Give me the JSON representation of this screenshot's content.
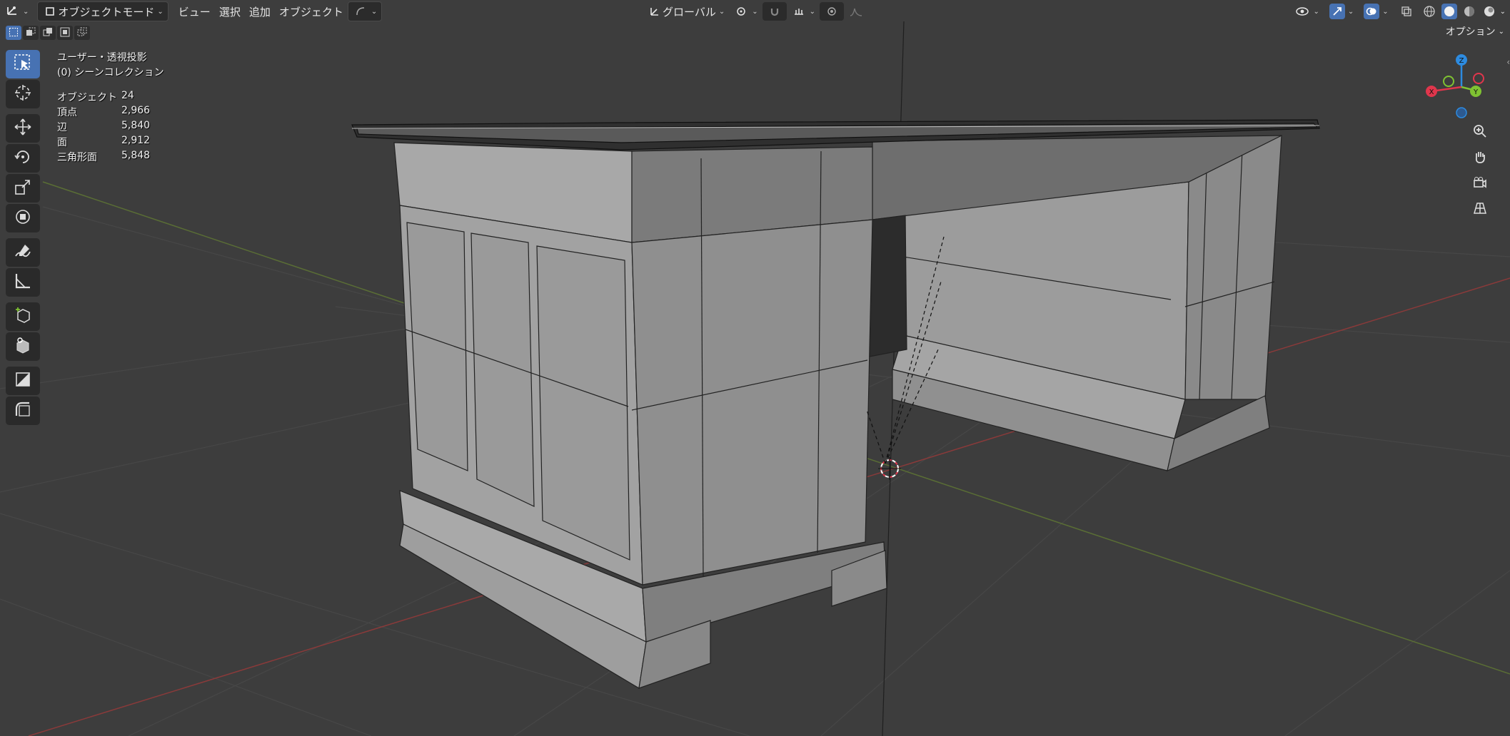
{
  "header": {
    "mode": "オブジェクトモード",
    "menu": [
      "ビュー",
      "選択",
      "追加",
      "オブジェクト"
    ],
    "transform_orientation": "グローバル"
  },
  "viewport": {
    "view_name": "ユーザー・透視投影",
    "collection": "(0) シーンコレクション",
    "options_label": "オプション",
    "stats": [
      {
        "label": "オブジェクト",
        "value": "24"
      },
      {
        "label": "頂点",
        "value": "2,966"
      },
      {
        "label": "辺",
        "value": "5,840"
      },
      {
        "label": "面",
        "value": "2,912"
      },
      {
        "label": "三角形面",
        "value": "5,848"
      }
    ]
  },
  "gizmo": {
    "x_label": "X",
    "y_label": "Y",
    "z_label": "Z"
  },
  "colors": {
    "background": "#3d3d3d",
    "accent": "#4772b3",
    "x_axis": "#e0364c",
    "y_axis": "#7fc232",
    "z_axis": "#2d8be0"
  },
  "tools": [
    "select-box",
    "cursor",
    "move",
    "rotate",
    "scale",
    "transform",
    "annotate",
    "measure",
    "add-cube",
    "add-object",
    "shade-smooth",
    "bevel"
  ]
}
